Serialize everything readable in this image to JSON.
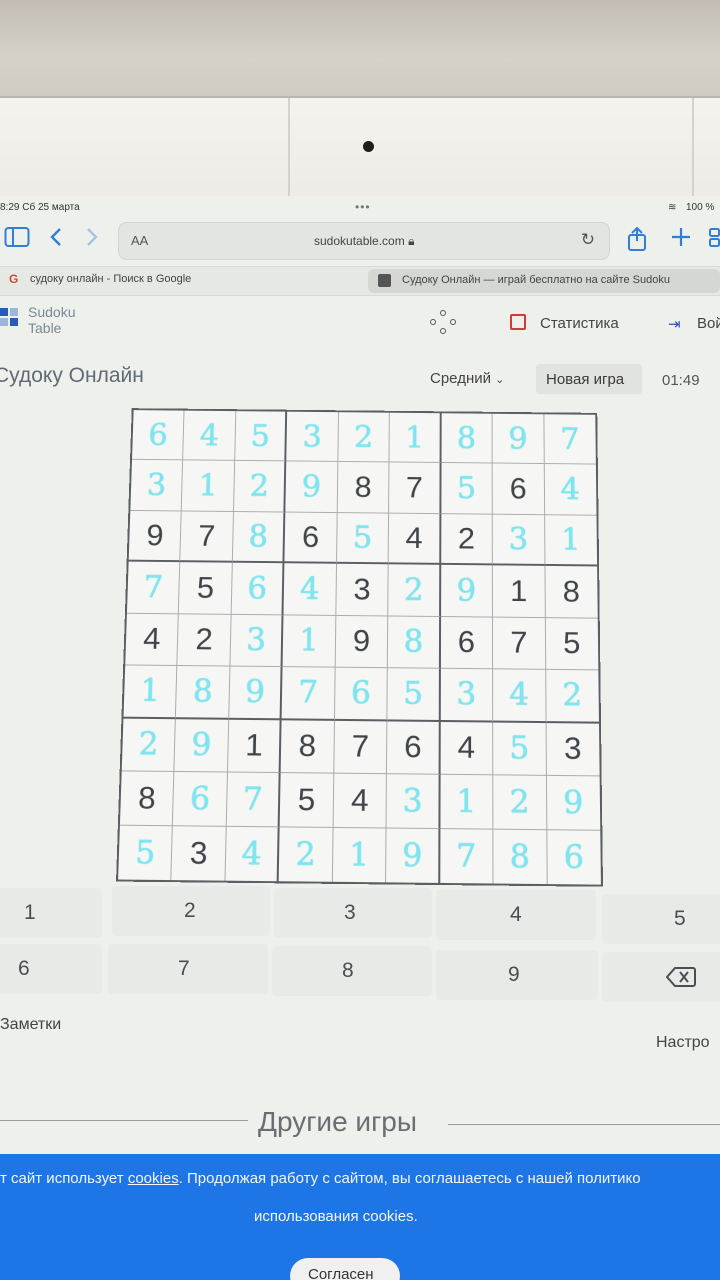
{
  "status_bar": {
    "time": "8:29",
    "date": "Сб 25 марта",
    "battery": "100 %"
  },
  "browser": {
    "reader_label": "AA",
    "url": "sudokutable.com",
    "tabs": [
      {
        "label": "судоку онлайн - Поиск в Google"
      },
      {
        "label": "Судоку Онлайн — играй бесплатно на сайте Sudoku"
      }
    ]
  },
  "site": {
    "logo_line1": "Sudoku",
    "logo_line2": "Table",
    "stats_label": "Статистика",
    "login_label": "Вой"
  },
  "game": {
    "title": "Судоку Онлайн",
    "difficulty": "Средний",
    "new_game_label": "Новая игра",
    "timer": "01:49",
    "grid": [
      [
        6,
        4,
        5,
        3,
        2,
        1,
        8,
        9,
        7
      ],
      [
        3,
        1,
        2,
        9,
        8,
        7,
        5,
        6,
        4
      ],
      [
        9,
        7,
        8,
        6,
        5,
        4,
        2,
        3,
        1
      ],
      [
        7,
        5,
        6,
        4,
        3,
        2,
        9,
        1,
        8
      ],
      [
        4,
        2,
        3,
        1,
        9,
        8,
        6,
        7,
        5
      ],
      [
        1,
        8,
        9,
        7,
        6,
        5,
        3,
        4,
        2
      ],
      [
        2,
        9,
        1,
        8,
        7,
        6,
        4,
        5,
        3
      ],
      [
        8,
        6,
        7,
        5,
        4,
        3,
        1,
        2,
        9
      ],
      [
        5,
        3,
        4,
        2,
        1,
        9,
        7,
        8,
        6
      ]
    ],
    "given_mask": [
      [
        0,
        0,
        0,
        0,
        0,
        0,
        0,
        0,
        0
      ],
      [
        0,
        0,
        0,
        0,
        1,
        1,
        0,
        1,
        0
      ],
      [
        1,
        1,
        0,
        1,
        0,
        1,
        1,
        0,
        0
      ],
      [
        0,
        1,
        0,
        0,
        1,
        0,
        0,
        1,
        1
      ],
      [
        1,
        1,
        0,
        0,
        1,
        0,
        1,
        1,
        1
      ],
      [
        0,
        0,
        0,
        0,
        0,
        0,
        0,
        0,
        0
      ],
      [
        0,
        0,
        1,
        1,
        1,
        1,
        1,
        0,
        1
      ],
      [
        1,
        0,
        0,
        1,
        1,
        0,
        0,
        0,
        0
      ],
      [
        0,
        1,
        0,
        0,
        0,
        0,
        0,
        0,
        0
      ]
    ],
    "numpad": [
      "1",
      "2",
      "3",
      "4",
      "5",
      "6",
      "7",
      "8",
      "9"
    ],
    "notes_label": "Заметки",
    "settings_label": "Настро"
  },
  "other_games": "Другие игры",
  "cookie": {
    "text_before": "от сайт использует ",
    "link": "cookies",
    "text_after": ". Продолжая работу с сайтом, вы соглашаетесь с нашей политико",
    "line2": "использования cookies.",
    "button": "Согласен"
  },
  "colors": {
    "accent": "#1e76e6",
    "user_digit": "#7de6f0",
    "given_digit": "#404448"
  },
  "icons": {
    "sidebar": "sidebar-icon",
    "back": "chevron-left-icon",
    "forward": "chevron-right-icon",
    "reload": "reload-icon",
    "share": "share-icon",
    "add_tab": "plus-icon",
    "tabs": "tabs-icon",
    "backspace": "backspace-icon"
  }
}
